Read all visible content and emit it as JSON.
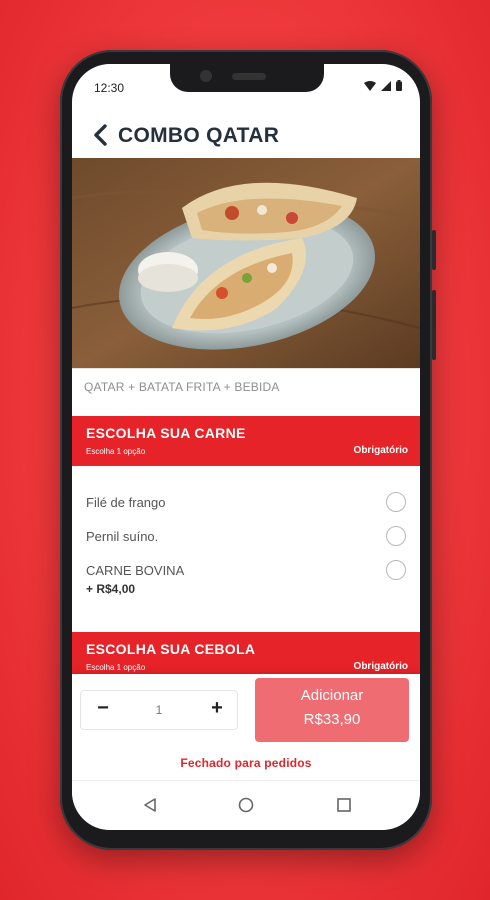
{
  "status": {
    "time": "12:30"
  },
  "header": {
    "title": "COMBO QATAR"
  },
  "product": {
    "description": "QATAR + BATATA FRITA + BEBIDA"
  },
  "sections": [
    {
      "title": "ESCOLHA SUA CARNE",
      "subtitle": "Escolha 1 opção",
      "required": "Obrigatório",
      "options": [
        {
          "label": "Filé de frango",
          "price": ""
        },
        {
          "label": "Pernil suíno.",
          "price": ""
        },
        {
          "label": "CARNE BOVINA",
          "price": "+ R$4,00"
        }
      ]
    },
    {
      "title": "ESCOLHA SUA CEBOLA",
      "subtitle": "Escolha 1 opção",
      "required": "Obrigatório"
    }
  ],
  "order": {
    "minus": "−",
    "quantity": "1",
    "plus": "+",
    "add_label": "Adicionar",
    "add_price": "R$33,90",
    "closed_notice": "Fechado para pedidos"
  },
  "icons": {
    "back": "chevron-left-icon",
    "wifi": "wifi-icon",
    "signal": "signal-icon",
    "battery": "battery-icon",
    "nav_back": "triangle-back-icon",
    "nav_home": "circle-home-icon",
    "nav_recent": "square-recent-icon"
  },
  "colors": {
    "brand_red": "#e52329",
    "button_red": "#ef6d72",
    "title_dark": "#25303d"
  }
}
